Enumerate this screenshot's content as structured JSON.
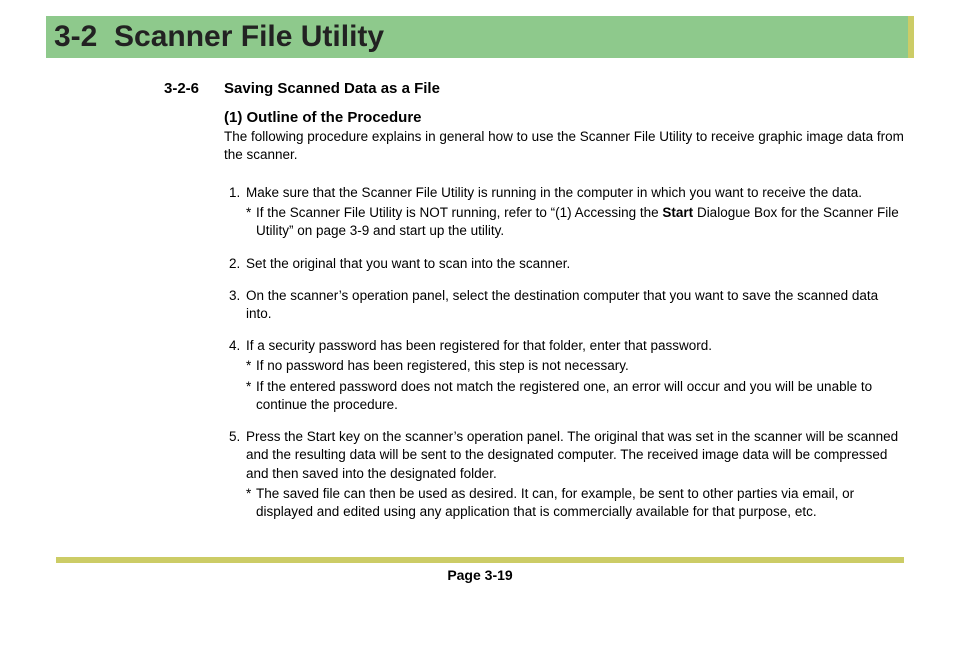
{
  "header": {
    "chapter": "3-2",
    "title": "Scanner File Utility"
  },
  "section": {
    "number": "3-2-6",
    "title": "Saving Scanned Data as a File",
    "subhead": "(1) Outline of the Procedure",
    "intro": "The following procedure explains in general how to use the Scanner File Utility to receive graphic image data from the scanner.",
    "steps": [
      {
        "text": "Make sure that the Scanner File Utility is running in the computer in which you want to receive the data.",
        "notes": [
          {
            "pre": "If the Scanner File Utility is NOT running, refer to “(1) Accessing the ",
            "bold": "Start",
            "post": " Dialogue Box for the Scanner File Utility” on page 3-9 and start up the utility."
          }
        ]
      },
      {
        "text": "Set the original that you want to scan into the scanner.",
        "notes": []
      },
      {
        "text": "On the scanner’s operation panel, select the destination computer that you want to save the scanned data into.",
        "notes": []
      },
      {
        "text": "If a security password has been registered for that folder, enter that password.",
        "notes": [
          {
            "pre": "If no password has been registered, this step is not necessary.",
            "bold": "",
            "post": ""
          },
          {
            "pre": "If the entered password does not match the registered one, an error will occur and you will be unable to continue the procedure.",
            "bold": "",
            "post": ""
          }
        ]
      },
      {
        "text": "Press the Start key on the scanner’s operation panel. The original that was set in the scanner will be scanned and the resulting data will be sent to the designated computer. The received image data will be compressed and then saved into the designated folder.",
        "notes": [
          {
            "pre": "The saved file can then be used as desired. It can, for example, be sent to other parties via email, or displayed and edited using any application that is commercially available for that purpose, etc.",
            "bold": "",
            "post": ""
          }
        ]
      }
    ]
  },
  "footer": {
    "page": "Page 3-19"
  }
}
